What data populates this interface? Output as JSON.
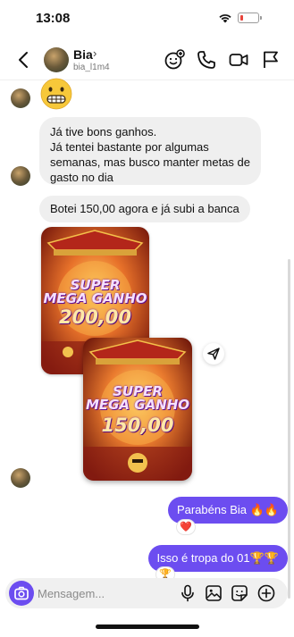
{
  "status_bar": {
    "time": "13:08",
    "battery_level": 0.15,
    "battery_color": "#e8453c"
  },
  "header": {
    "contact_name": "Bia",
    "contact_handle": "bia_l1m4",
    "icons": [
      "back-icon",
      "avatar-effects-icon",
      "phone-icon",
      "video-icon",
      "flag-icon"
    ]
  },
  "chat": {
    "emoji_message": "grimacing-face-emoji",
    "messages": [
      {
        "from": "Bia",
        "lines": [
          "Já tive bons ganhos.",
          "Já tentei bastante por algumas",
          "semanas, mas busco manter metas de",
          "gasto no dia"
        ]
      },
      {
        "from": "Bia",
        "lines": [
          "Botei 150,00 agora e já subi a banca"
        ]
      }
    ],
    "images": [
      {
        "title_line1": "SUPER",
        "title_line2": "MEGA GANHO",
        "amount": "200,00"
      },
      {
        "title_line1": "SUPER",
        "title_line2": "MEGA GANHO",
        "amount": "150,00"
      }
    ],
    "outgoing": [
      {
        "text": "Parabéns Bia 🔥🔥",
        "reaction": "❤️"
      },
      {
        "text": "Isso é tropa do 01🏆🏆",
        "reaction": "🏆"
      }
    ]
  },
  "composer": {
    "placeholder": "Mensagem...",
    "value": ""
  },
  "colors": {
    "accent": "#6c4df0",
    "incoming_bubble": "#efefef",
    "outgoing_bubble": "#6c4df0"
  }
}
